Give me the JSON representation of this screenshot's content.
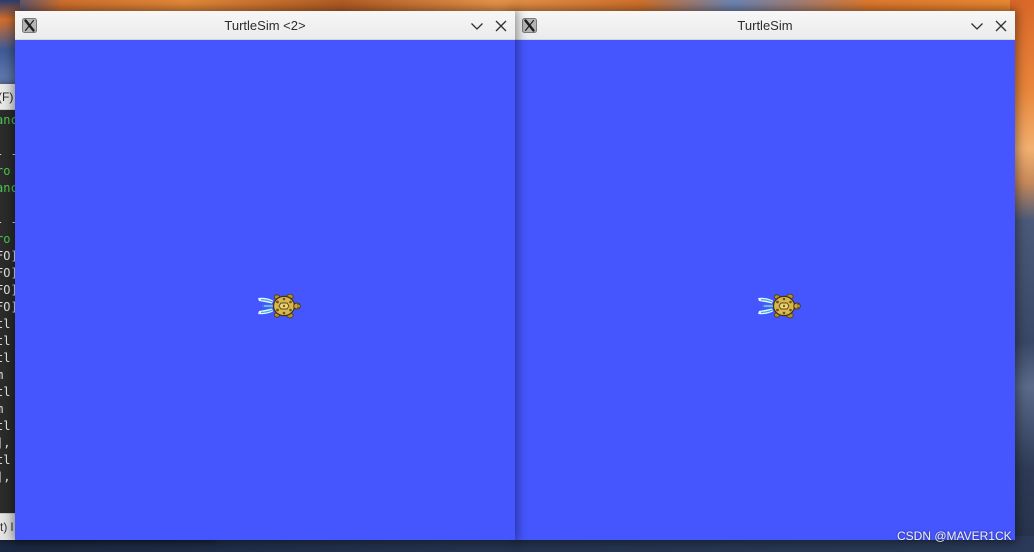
{
  "desktop": {
    "watermark": "CSDN @MAVER1CK",
    "base_color": "#22304b"
  },
  "terminal": {
    "menu_fragment": "(F)",
    "background_color": "#2b2b2b",
    "lines": [
      {
        "text": "anc",
        "color": "#4ec94e"
      },
      {
        "text": "",
        "color": "#e6e6e6"
      },
      {
        "text": "- -",
        "color": "#d4d4d4"
      },
      {
        "text": "ro",
        "color": "#4ec94e"
      },
      {
        "text": "anc",
        "color": "#4ec94e"
      },
      {
        "text": "",
        "color": "#e6e6e6"
      },
      {
        "text": "- -",
        "color": "#d4d4d4"
      },
      {
        "text": "ro",
        "color": "#4ec94e"
      },
      {
        "text": "FO]",
        "color": "#e6e6e6"
      },
      {
        "text": "FO]",
        "color": "#e6e6e6"
      },
      {
        "text": "FO]",
        "color": "#e6e6e6"
      },
      {
        "text": "FO]",
        "color": "#e6e6e6"
      },
      {
        "text": "tl",
        "color": "#e6e6e6"
      },
      {
        "text": "tl",
        "color": "#e6e6e6"
      },
      {
        "text": "tl",
        "color": "#e6e6e6"
      },
      {
        "text": "m",
        "color": "#e6e6e6"
      },
      {
        "text": "tl",
        "color": "#e6e6e6"
      },
      {
        "text": "m",
        "color": "#e6e6e6"
      },
      {
        "text": "tl",
        "color": "#e6e6e6"
      },
      {
        "text": "],",
        "color": "#e6e6e6"
      },
      {
        "text": "tl",
        "color": "#e6e6e6"
      },
      {
        "text": "],",
        "color": "#e6e6e6"
      }
    ],
    "status_fragment": "t) l"
  },
  "windows": {
    "left": {
      "title": "TurtleSim <2>",
      "app_icon": "x11-icon",
      "minimize_icon": "chevron-down-icon",
      "close_icon": "close-icon",
      "canvas_color": "#4556ff",
      "turtle": {
        "icon": "turtle-icon",
        "heading_deg": 0
      }
    },
    "right": {
      "title": "TurtleSim",
      "app_icon": "x11-icon",
      "minimize_icon": "chevron-down-icon",
      "close_icon": "close-icon",
      "canvas_color": "#4556ff",
      "turtle": {
        "icon": "turtle-icon",
        "heading_deg": 0
      }
    }
  }
}
